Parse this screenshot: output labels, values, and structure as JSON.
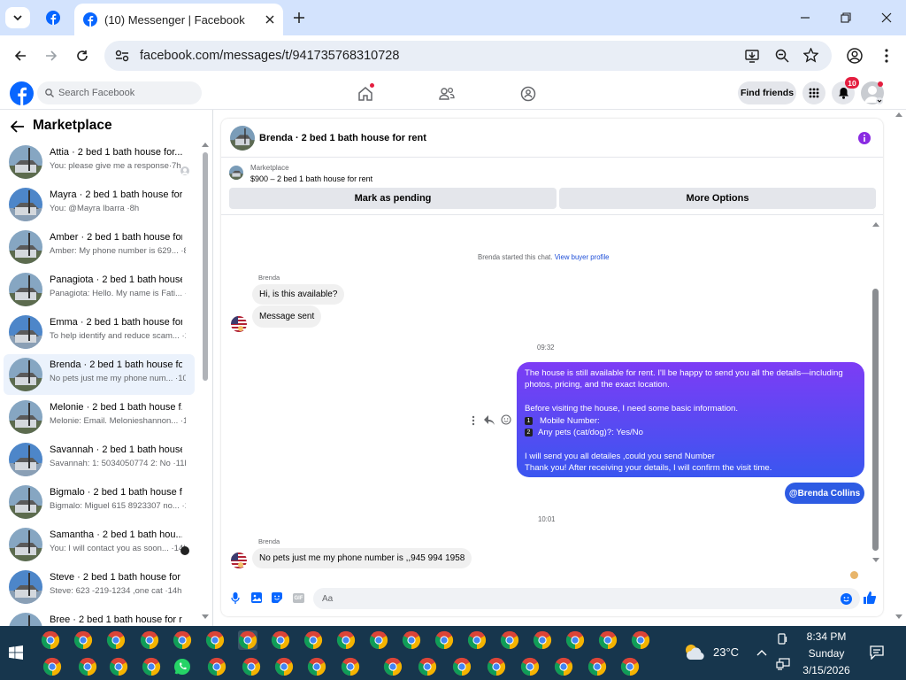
{
  "browser": {
    "tab_title": "(10) Messenger | Facebook",
    "url": "facebook.com/messages/t/941735768310728"
  },
  "header": {
    "search_placeholder": "Search Facebook",
    "find_friends": "Find friends",
    "notif_count": "10"
  },
  "sidebar": {
    "title": "Marketplace",
    "items": [
      {
        "title": "Attia · 2 bed 1 bath house for...",
        "snippet": "You: please give me a response·7h"
      },
      {
        "title": "Mayra · 2 bed 1 bath house for ...",
        "snippet": "You: @Mayra Ibarra ·8h"
      },
      {
        "title": "Amber · 2 bed 1 bath house for...",
        "snippet": "Amber: My phone number is 629... ·8h"
      },
      {
        "title": "Panagiota · 2 bed 1 bath house ...",
        "snippet": "Panagiota: Hello. My name is Fati... ·9h"
      },
      {
        "title": "Emma · 2 bed 1 bath house for ...",
        "snippet": "To help identify and reduce scam... ·10h"
      },
      {
        "title": "Brenda · 2 bed 1 bath house for...",
        "snippet": "No pets just me my phone num... ·10h"
      },
      {
        "title": "Melonie · 2 bed 1 bath house f...",
        "snippet": "Melonie: Email. Melonieshannon... ·10h"
      },
      {
        "title": "Savannah · 2 bed 1 bath house ...",
        "snippet": "Savannah: 1: 5034050774 2: No ·11h"
      },
      {
        "title": "Bigmalo · 2 bed 1 bath house f...",
        "snippet": "Bigmalo: Miguel 615 8923307 no... ·14h"
      },
      {
        "title": "Samantha · 2 bed 1 bath hou...",
        "snippet": "You: I will contact you as soon... ·14h"
      },
      {
        "title": "Steve · 2 bed 1 bath house for r...",
        "snippet": "Steve: 623 -219-1234 ,one cat ·14h"
      },
      {
        "title": "Bree · 2 bed 1 bath house for re...",
        "snippet": ""
      }
    ]
  },
  "chat": {
    "title": "Brenda · 2 bed 1 bath house for rent",
    "listing_label": "Marketplace",
    "listing_price": "$900 – 2 bed 1 bath house for rent",
    "mark_pending": "Mark as pending",
    "more_options": "More Options",
    "started_text": "Brenda started this chat.",
    "view_profile": "View buyer profile",
    "sender1": "Brenda",
    "msg1": "Hi, is this available?",
    "msg2": "Message sent",
    "time1": "09:32",
    "out_line1": "The house is still available for rent. I'll be happy to send you all the details—including",
    "out_line2": "photos, pricing, and the exact location.",
    "out_line3": "Before visiting the house, I need some basic information.",
    "out_line4": "Mobile Number:",
    "out_line5": "Any pets (cat/dog)?: Yes/No",
    "out_line6": "I will send you all detailes ,could you send Number",
    "out_line7": "Thank you! After receiving your details, I will confirm the visit time.",
    "num1": "1",
    "num2": "2",
    "mention": "@Brenda Collins",
    "time2": "10:01",
    "sender2": "Brenda",
    "msg3": "No pets just me my phone number is ,,945 994 1958",
    "composer_placeholder": "Aa"
  },
  "taskbar": {
    "weather": "23°C",
    "time": "8:34 PM",
    "day": "Sunday",
    "date": "3/15/2026"
  },
  "colors": {
    "fb_blue": "#0866ff",
    "purple": "#7d3cf5",
    "taskbar": "#17364d"
  }
}
